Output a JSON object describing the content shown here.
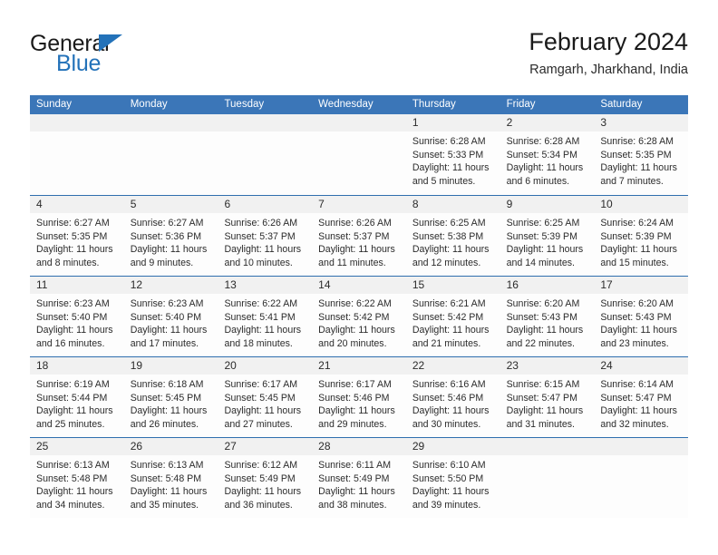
{
  "logo": {
    "word_one": "General",
    "word_two": "Blue",
    "triangle_color": "#2372b9",
    "triangle_icon": "triangle-icon"
  },
  "header": {
    "title": "February 2024",
    "location": "Ramgarh, Jharkhand, India"
  },
  "theme": {
    "header_blue": "#3b76b8",
    "row_rule_blue": "#2f6fae",
    "day_band_gray": "#f1f1f1"
  },
  "weekdays": [
    "Sunday",
    "Monday",
    "Tuesday",
    "Wednesday",
    "Thursday",
    "Friday",
    "Saturday"
  ],
  "weeks": [
    [
      {
        "day": "",
        "lines": []
      },
      {
        "day": "",
        "lines": []
      },
      {
        "day": "",
        "lines": []
      },
      {
        "day": "",
        "lines": []
      },
      {
        "day": "1",
        "lines": [
          "Sunrise: 6:28 AM",
          "Sunset: 5:33 PM",
          "Daylight: 11 hours",
          "and 5 minutes."
        ]
      },
      {
        "day": "2",
        "lines": [
          "Sunrise: 6:28 AM",
          "Sunset: 5:34 PM",
          "Daylight: 11 hours",
          "and 6 minutes."
        ]
      },
      {
        "day": "3",
        "lines": [
          "Sunrise: 6:28 AM",
          "Sunset: 5:35 PM",
          "Daylight: 11 hours",
          "and 7 minutes."
        ]
      }
    ],
    [
      {
        "day": "4",
        "lines": [
          "Sunrise: 6:27 AM",
          "Sunset: 5:35 PM",
          "Daylight: 11 hours",
          "and 8 minutes."
        ]
      },
      {
        "day": "5",
        "lines": [
          "Sunrise: 6:27 AM",
          "Sunset: 5:36 PM",
          "Daylight: 11 hours",
          "and 9 minutes."
        ]
      },
      {
        "day": "6",
        "lines": [
          "Sunrise: 6:26 AM",
          "Sunset: 5:37 PM",
          "Daylight: 11 hours",
          "and 10 minutes."
        ]
      },
      {
        "day": "7",
        "lines": [
          "Sunrise: 6:26 AM",
          "Sunset: 5:37 PM",
          "Daylight: 11 hours",
          "and 11 minutes."
        ]
      },
      {
        "day": "8",
        "lines": [
          "Sunrise: 6:25 AM",
          "Sunset: 5:38 PM",
          "Daylight: 11 hours",
          "and 12 minutes."
        ]
      },
      {
        "day": "9",
        "lines": [
          "Sunrise: 6:25 AM",
          "Sunset: 5:39 PM",
          "Daylight: 11 hours",
          "and 14 minutes."
        ]
      },
      {
        "day": "10",
        "lines": [
          "Sunrise: 6:24 AM",
          "Sunset: 5:39 PM",
          "Daylight: 11 hours",
          "and 15 minutes."
        ]
      }
    ],
    [
      {
        "day": "11",
        "lines": [
          "Sunrise: 6:23 AM",
          "Sunset: 5:40 PM",
          "Daylight: 11 hours",
          "and 16 minutes."
        ]
      },
      {
        "day": "12",
        "lines": [
          "Sunrise: 6:23 AM",
          "Sunset: 5:40 PM",
          "Daylight: 11 hours",
          "and 17 minutes."
        ]
      },
      {
        "day": "13",
        "lines": [
          "Sunrise: 6:22 AM",
          "Sunset: 5:41 PM",
          "Daylight: 11 hours",
          "and 18 minutes."
        ]
      },
      {
        "day": "14",
        "lines": [
          "Sunrise: 6:22 AM",
          "Sunset: 5:42 PM",
          "Daylight: 11 hours",
          "and 20 minutes."
        ]
      },
      {
        "day": "15",
        "lines": [
          "Sunrise: 6:21 AM",
          "Sunset: 5:42 PM",
          "Daylight: 11 hours",
          "and 21 minutes."
        ]
      },
      {
        "day": "16",
        "lines": [
          "Sunrise: 6:20 AM",
          "Sunset: 5:43 PM",
          "Daylight: 11 hours",
          "and 22 minutes."
        ]
      },
      {
        "day": "17",
        "lines": [
          "Sunrise: 6:20 AM",
          "Sunset: 5:43 PM",
          "Daylight: 11 hours",
          "and 23 minutes."
        ]
      }
    ],
    [
      {
        "day": "18",
        "lines": [
          "Sunrise: 6:19 AM",
          "Sunset: 5:44 PM",
          "Daylight: 11 hours",
          "and 25 minutes."
        ]
      },
      {
        "day": "19",
        "lines": [
          "Sunrise: 6:18 AM",
          "Sunset: 5:45 PM",
          "Daylight: 11 hours",
          "and 26 minutes."
        ]
      },
      {
        "day": "20",
        "lines": [
          "Sunrise: 6:17 AM",
          "Sunset: 5:45 PM",
          "Daylight: 11 hours",
          "and 27 minutes."
        ]
      },
      {
        "day": "21",
        "lines": [
          "Sunrise: 6:17 AM",
          "Sunset: 5:46 PM",
          "Daylight: 11 hours",
          "and 29 minutes."
        ]
      },
      {
        "day": "22",
        "lines": [
          "Sunrise: 6:16 AM",
          "Sunset: 5:46 PM",
          "Daylight: 11 hours",
          "and 30 minutes."
        ]
      },
      {
        "day": "23",
        "lines": [
          "Sunrise: 6:15 AM",
          "Sunset: 5:47 PM",
          "Daylight: 11 hours",
          "and 31 minutes."
        ]
      },
      {
        "day": "24",
        "lines": [
          "Sunrise: 6:14 AM",
          "Sunset: 5:47 PM",
          "Daylight: 11 hours",
          "and 32 minutes."
        ]
      }
    ],
    [
      {
        "day": "25",
        "lines": [
          "Sunrise: 6:13 AM",
          "Sunset: 5:48 PM",
          "Daylight: 11 hours",
          "and 34 minutes."
        ]
      },
      {
        "day": "26",
        "lines": [
          "Sunrise: 6:13 AM",
          "Sunset: 5:48 PM",
          "Daylight: 11 hours",
          "and 35 minutes."
        ]
      },
      {
        "day": "27",
        "lines": [
          "Sunrise: 6:12 AM",
          "Sunset: 5:49 PM",
          "Daylight: 11 hours",
          "and 36 minutes."
        ]
      },
      {
        "day": "28",
        "lines": [
          "Sunrise: 6:11 AM",
          "Sunset: 5:49 PM",
          "Daylight: 11 hours",
          "and 38 minutes."
        ]
      },
      {
        "day": "29",
        "lines": [
          "Sunrise: 6:10 AM",
          "Sunset: 5:50 PM",
          "Daylight: 11 hours",
          "and 39 minutes."
        ]
      },
      {
        "day": "",
        "lines": []
      },
      {
        "day": "",
        "lines": []
      }
    ]
  ]
}
